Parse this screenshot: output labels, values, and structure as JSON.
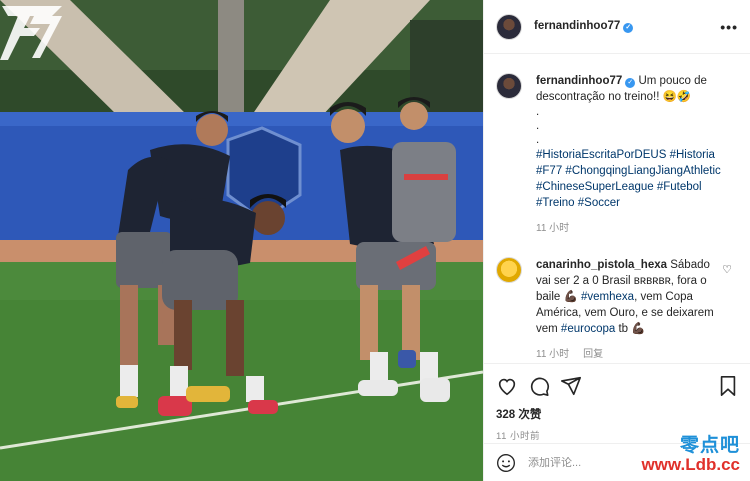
{
  "post": {
    "username": "fernandinhoo77",
    "caption": "Um pouco de descontração no treino!! 😆🤣",
    "dots": [
      ".",
      ".",
      "."
    ],
    "hashtags": [
      "#HistoriaEscritaPorDEUS",
      "#Historia",
      "#F77",
      "#ChongqingLiangJiangAthletic",
      "#ChineseSuperLeague",
      "#Futebol",
      "#Treino",
      "#Soccer"
    ],
    "caption_time": "11 小时"
  },
  "comment": {
    "username": "canarinho_pistola_hexa",
    "text_1": "Sábado vai ser 2 a 0 Brasil ʙʀʙʀʙʀ, fora o baile 💪🏿 ",
    "tag_1": "#vemhexa",
    "text_2": ", vem Copa América, vem Ouro, e se deixarem vem ",
    "tag_2": "#eurocopa",
    "text_3": " tb 💪🏿",
    "time": "11 小时",
    "reply_label": "回复"
  },
  "stats": {
    "likes": "328 次赞",
    "time": "11 小时前"
  },
  "add_comment": {
    "placeholder": "添加评论..."
  },
  "watermark": {
    "chinese": "零点吧",
    "url": "www.Ldb.cc"
  },
  "icons": {
    "like": "heart-icon",
    "comment": "comment-icon",
    "share": "share-icon",
    "save": "bookmark-icon",
    "emoji": "emoji-icon",
    "more": "more-icon"
  },
  "colors": {
    "verified": "#3897f0",
    "hashtag": "#00376b",
    "muted": "#8e8e8e",
    "watermark_cn": "#1e90d8",
    "watermark_url": "#e0312b"
  }
}
